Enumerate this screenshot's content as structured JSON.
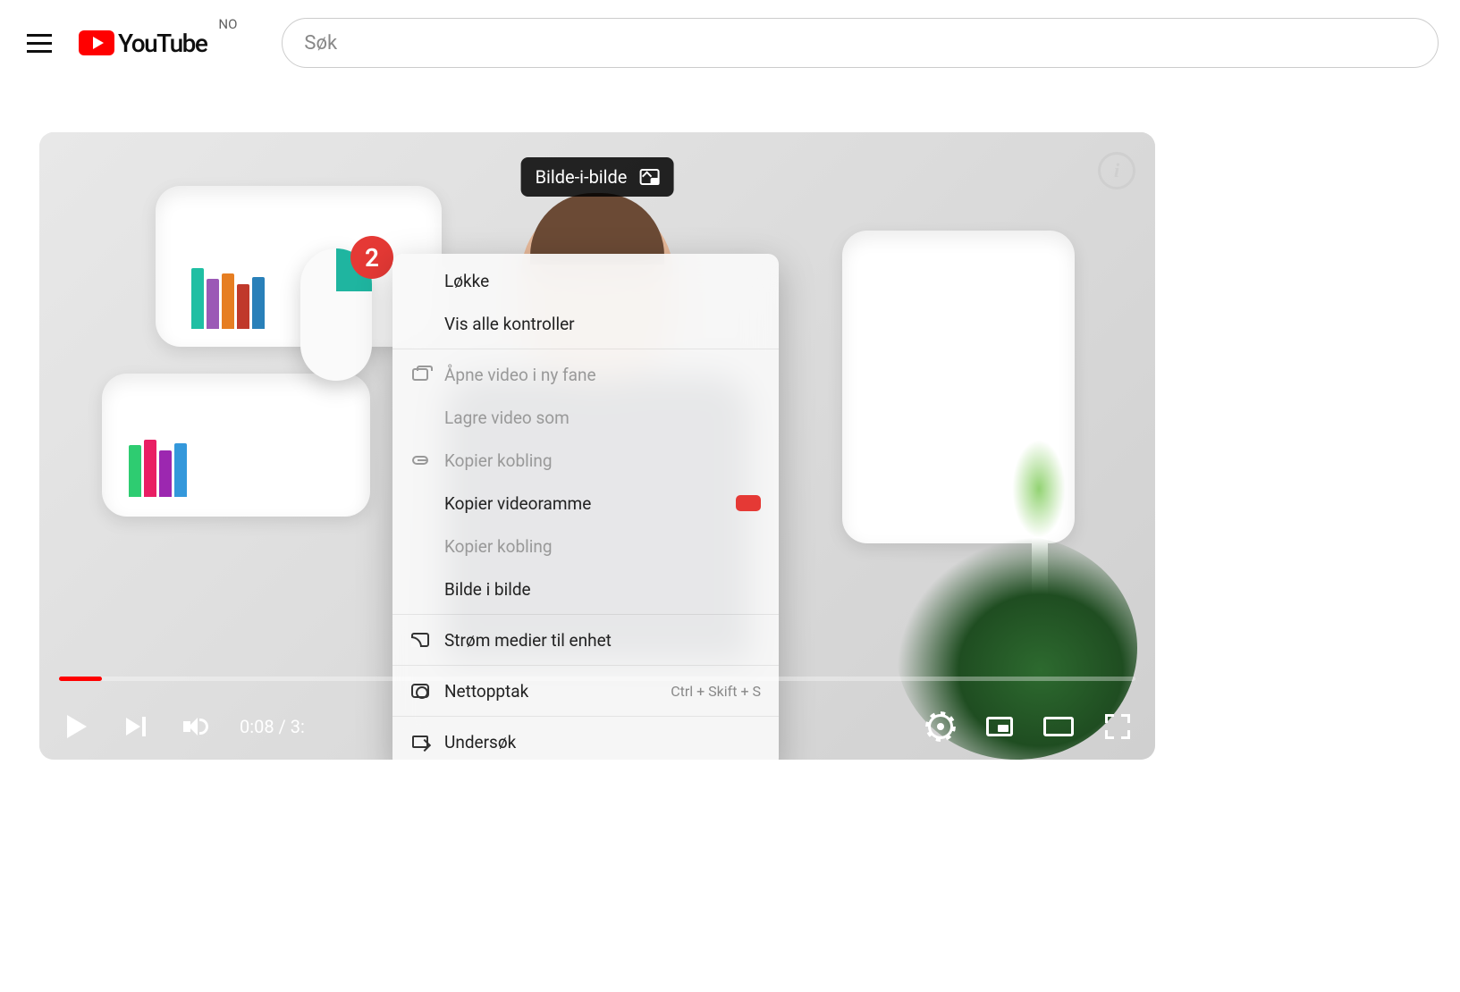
{
  "header": {
    "logo_text": "YouTube",
    "country_code": "NO",
    "search_placeholder": "Søk"
  },
  "pip_tooltip": "Bilde-i-bilde",
  "mouse_badge": "2",
  "context_menu": {
    "items": [
      {
        "label": "Løkke",
        "icon": "",
        "disabled": false
      },
      {
        "label": "Vis alle kontroller",
        "icon": "",
        "disabled": false
      },
      {
        "sep": true
      },
      {
        "label": "Åpne video i ny fane",
        "icon": "tab",
        "disabled": true
      },
      {
        "label": "Lagre video som",
        "icon": "",
        "disabled": true
      },
      {
        "label": "Kopier kobling",
        "icon": "link",
        "disabled": true
      },
      {
        "label": "Kopier videoramme",
        "icon": "",
        "disabled": false,
        "preview": true
      },
      {
        "label": "Kopier kobling",
        "icon": "",
        "disabled": true
      },
      {
        "label": "Bilde i bilde",
        "icon": "",
        "disabled": false
      },
      {
        "sep": true
      },
      {
        "label": "Strøm medier til enhet",
        "icon": "cast",
        "disabled": false
      },
      {
        "sep": true
      },
      {
        "label": "Nettopptak",
        "icon": "cam",
        "disabled": false,
        "shortcut": "Ctrl + Skift + S"
      },
      {
        "sep": true
      },
      {
        "label": "Undersøk",
        "icon": "inspect",
        "disabled": false
      }
    ]
  },
  "player": {
    "current_time": "0:08",
    "duration_partial": "3:",
    "progress_pct": 4
  },
  "video_title_partial": ""
}
